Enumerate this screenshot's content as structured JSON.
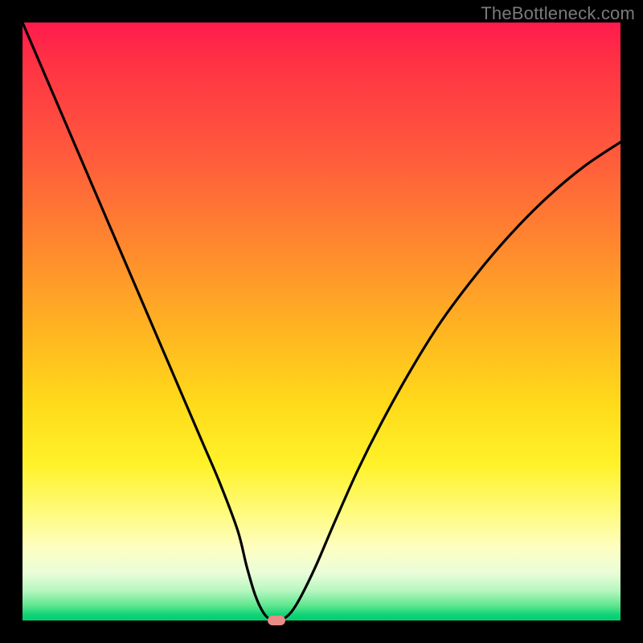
{
  "watermark": "TheBottleneck.com",
  "colors": {
    "frame": "#000000",
    "curve": "#000000",
    "marker": "#e98b86",
    "gradient_top": "#ff1a4d",
    "gradient_bottom": "#00cf73"
  },
  "chart_data": {
    "type": "line",
    "title": "",
    "xlabel": "",
    "ylabel": "",
    "xlim": [
      0,
      100
    ],
    "ylim": [
      0,
      100
    ],
    "grid": false,
    "legend": false,
    "series": [
      {
        "name": "bottleneck-curve",
        "x": [
          0,
          3,
          6,
          9,
          12,
          15,
          18,
          21,
          24,
          27,
          30,
          33,
          36,
          37.5,
          39,
          40.5,
          42,
          44,
          46,
          49,
          52,
          56,
          60,
          65,
          70,
          76,
          82,
          88,
          94,
          100
        ],
        "y": [
          100,
          93,
          86,
          79,
          72,
          65,
          58,
          51,
          44,
          37,
          30,
          23,
          15,
          9,
          4,
          1,
          0,
          0.5,
          3,
          9,
          16,
          25,
          33,
          42,
          50,
          58,
          65,
          71,
          76,
          80
        ]
      }
    ],
    "annotations": [
      {
        "name": "min-marker",
        "x": 42.5,
        "y": 0
      }
    ],
    "notes": "V-shaped bottleneck curve over a vertical rainbow gradient (red=high bottleneck at top, green=0% at bottom). Minimum of curve sits near x≈42.5% where the small rounded marker is drawn at y≈0."
  }
}
